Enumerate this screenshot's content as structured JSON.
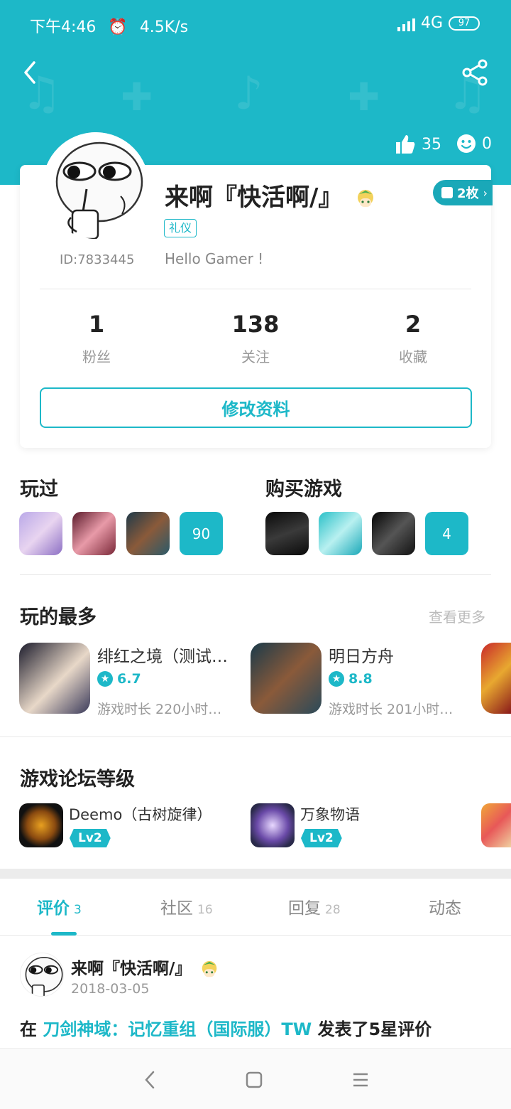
{
  "status_bar": {
    "time": "下午4:46",
    "speed": "4.5K/s",
    "network": "4G",
    "battery": "97"
  },
  "header": {
    "likes": "35",
    "smiles": "0"
  },
  "profile": {
    "name": "来啊『快活啊/』",
    "id": "ID:7833445",
    "tag": "礼仪",
    "bio": "Hello Gamer !",
    "medal": "2枚",
    "stats": [
      {
        "num": "1",
        "label": "粉丝"
      },
      {
        "num": "138",
        "label": "关注"
      },
      {
        "num": "2",
        "label": "收藏"
      }
    ],
    "edit_label": "修改资料"
  },
  "played": {
    "title": "玩过",
    "count": "90"
  },
  "bought": {
    "title": "购买游戏",
    "count": "4"
  },
  "most_played": {
    "title": "玩的最多",
    "more": "查看更多",
    "games": [
      {
        "name": "绯红之境（测试…",
        "rating": "6.7",
        "time": "游戏时长 220小时…"
      },
      {
        "name": "明日方舟",
        "rating": "8.8",
        "time": "游戏时长 201小时…"
      }
    ]
  },
  "forum": {
    "title": "游戏论坛等级",
    "items": [
      {
        "name": "Deemo（古树旋律）",
        "level": "Lv2"
      },
      {
        "name": "万象物语",
        "level": "Lv2"
      }
    ]
  },
  "tabs": [
    {
      "label": "评价",
      "count": "3"
    },
    {
      "label": "社区",
      "count": "16"
    },
    {
      "label": "回复",
      "count": "28"
    },
    {
      "label": "动态",
      "count": ""
    }
  ],
  "post": {
    "name": "来啊『快活啊/』",
    "date": "2018-03-05",
    "prefix": "在 ",
    "game": "刀剑神域：记忆重组（国际服）TW",
    "suffix": " 发表了5星评价"
  }
}
